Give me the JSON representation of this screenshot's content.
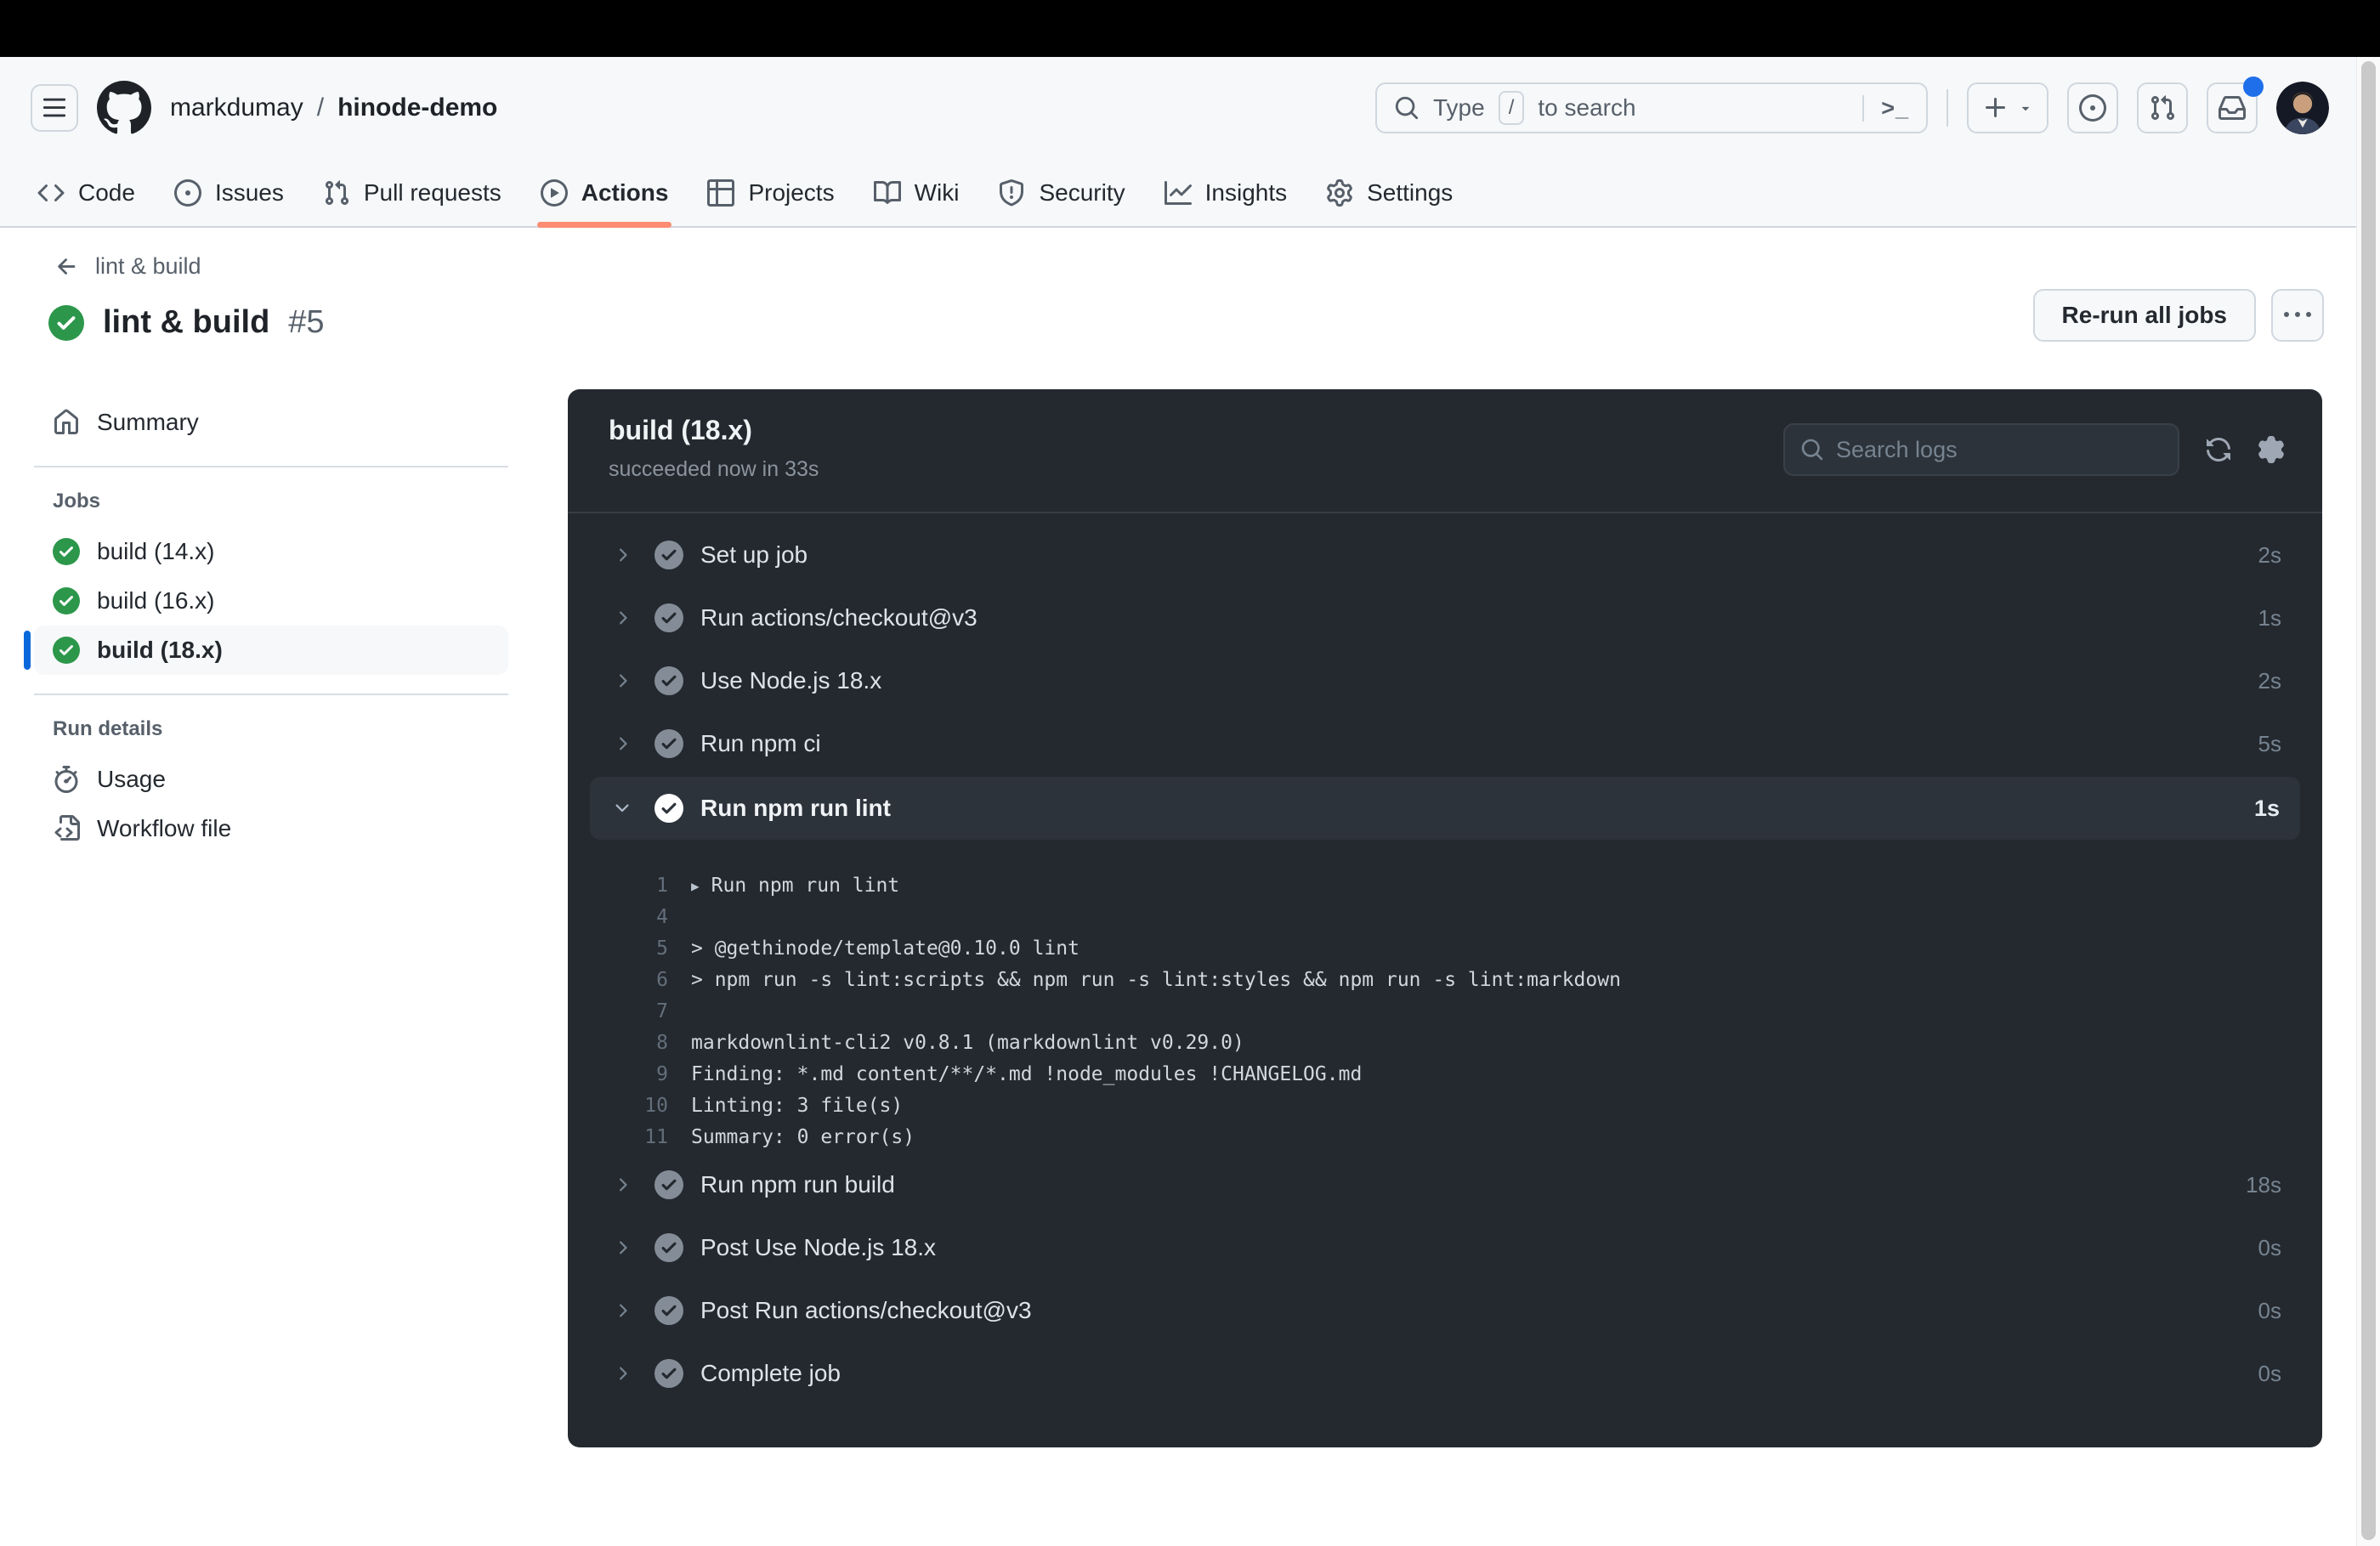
{
  "colors": {
    "accent_orange": "#fd8c73",
    "accent_blue": "#0969da",
    "success_green": "#2c974b",
    "panel_bg": "#24292f"
  },
  "header": {
    "breadcrumb": {
      "owner": "markdumay",
      "separator": "/",
      "repo": "hinode-demo"
    },
    "search": {
      "prefix": "Type",
      "key_hint": "/",
      "suffix": "to search",
      "terminal_hint": ">_"
    },
    "nav": [
      {
        "label": "Code"
      },
      {
        "label": "Issues"
      },
      {
        "label": "Pull requests"
      },
      {
        "label": "Actions",
        "active": true
      },
      {
        "label": "Projects"
      },
      {
        "label": "Wiki"
      },
      {
        "label": "Security"
      },
      {
        "label": "Insights"
      },
      {
        "label": "Settings"
      }
    ]
  },
  "page": {
    "back_label": "lint & build",
    "title": "lint & build",
    "run_number": "#5",
    "rerun_button": "Re-run all jobs"
  },
  "sidebar": {
    "summary": "Summary",
    "jobs_header": "Jobs",
    "jobs": [
      {
        "label": "build (14.x)"
      },
      {
        "label": "build (16.x)"
      },
      {
        "label": "build (18.x)",
        "selected": true
      }
    ],
    "run_details_header": "Run details",
    "usage": "Usage",
    "workflow_file": "Workflow file"
  },
  "log_panel": {
    "job_title": "build (18.x)",
    "job_status": "succeeded now in 33s",
    "search_placeholder": "Search logs",
    "steps": [
      {
        "name": "Set up job",
        "duration": "2s"
      },
      {
        "name": "Run actions/checkout@v3",
        "duration": "1s"
      },
      {
        "name": "Use Node.js 18.x",
        "duration": "2s"
      },
      {
        "name": "Run npm ci",
        "duration": "5s"
      },
      {
        "name": "Run npm run lint",
        "duration": "1s",
        "expanded": true
      },
      {
        "name": "Run npm run build",
        "duration": "18s"
      },
      {
        "name": "Post Use Node.js 18.x",
        "duration": "0s"
      },
      {
        "name": "Post Run actions/checkout@v3",
        "duration": "0s"
      },
      {
        "name": "Complete job",
        "duration": "0s"
      }
    ],
    "log_lines": [
      {
        "num": "1",
        "text": "Run npm run lint",
        "group": true
      },
      {
        "num": "4",
        "text": ""
      },
      {
        "num": "5",
        "text": "> @gethinode/template@0.10.0 lint"
      },
      {
        "num": "6",
        "text": "> npm run -s lint:scripts && npm run -s lint:styles && npm run -s lint:markdown"
      },
      {
        "num": "7",
        "text": ""
      },
      {
        "num": "8",
        "text": "markdownlint-cli2 v0.8.1 (markdownlint v0.29.0)"
      },
      {
        "num": "9",
        "text": "Finding: *.md content/**/*.md !node_modules !CHANGELOG.md"
      },
      {
        "num": "10",
        "text": "Linting: 3 file(s)"
      },
      {
        "num": "11",
        "text": "Summary: 0 error(s)"
      }
    ]
  }
}
